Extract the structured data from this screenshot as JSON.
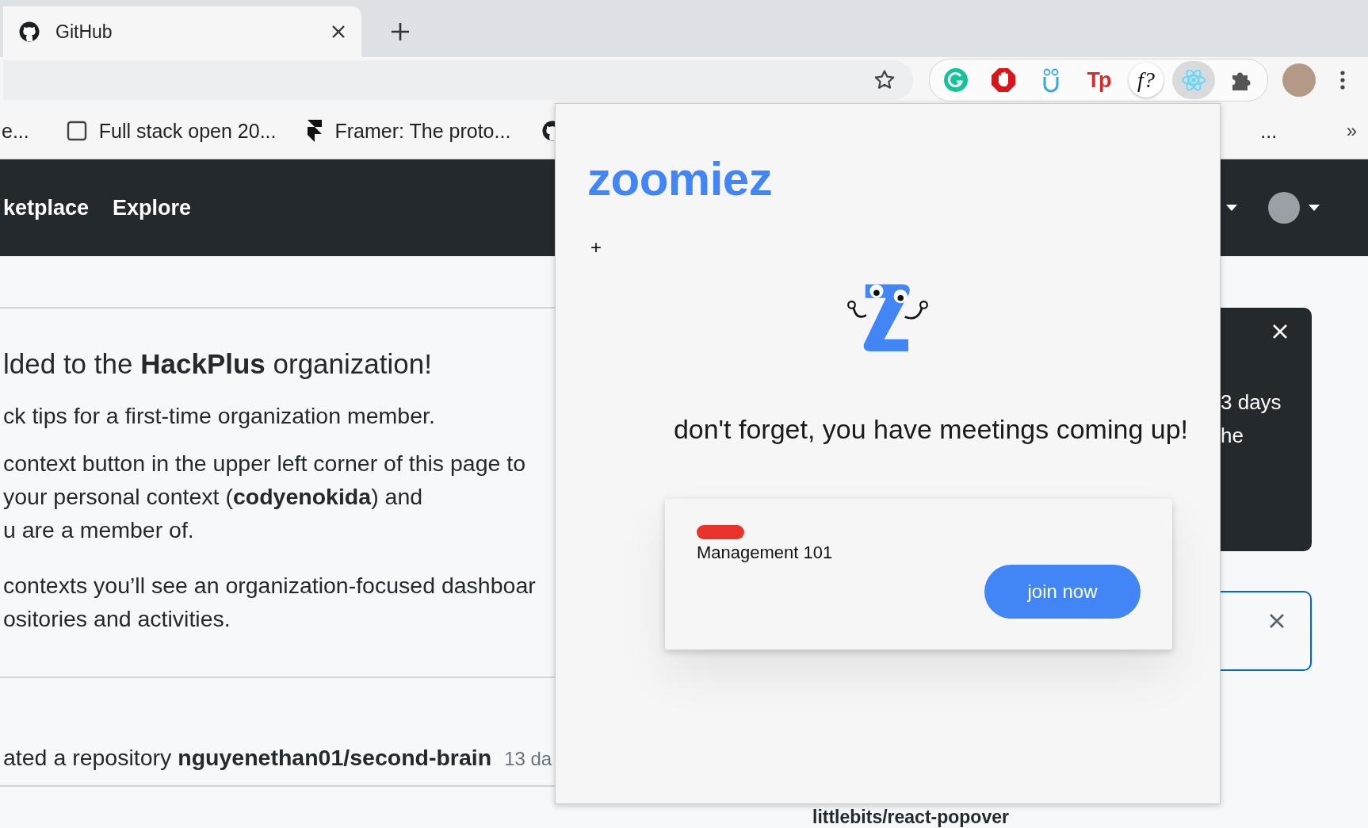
{
  "browser": {
    "tabs": [
      {
        "title": "GitHub",
        "selected": true
      }
    ],
    "extensions": [
      {
        "kind": "grammarly",
        "selected": false
      },
      {
        "kind": "stop-hand",
        "selected": false
      },
      {
        "kind": "owl",
        "selected": false
      },
      {
        "kind": "text",
        "label": "Tp",
        "selected": false
      },
      {
        "kind": "text-circle",
        "label": "f?",
        "selected": false
      },
      {
        "kind": "atom",
        "selected": true
      },
      {
        "kind": "puzzle",
        "selected": false
      }
    ],
    "bookmarks": [
      {
        "kind": "plain",
        "label": "e..."
      },
      {
        "kind": "page",
        "label": "Full stack open 20..."
      },
      {
        "kind": "framer",
        "label": "Framer: The proto..."
      },
      {
        "kind": "github"
      },
      {
        "kind": "plain",
        "label": "..."
      }
    ],
    "bookmarks_overflow": "»"
  },
  "github": {
    "nav": [
      "ketplace",
      "Explore"
    ],
    "welcome": {
      "heading": "lded to the **HackPlus** organization!",
      "paragraphs": [
        [
          "ck tips for a first-time organization member."
        ],
        [
          "context button in the upper left corner of this page to",
          "your personal context (**codyenokida**) and",
          "u are a member of."
        ],
        [
          "contexts you’ll see an organization-focused dashboar",
          "ositories and activities."
        ]
      ]
    },
    "activity": {
      "text": "ated a repository **nguyenethan01/second-brain**",
      "time": "13 da"
    },
    "repo_link": "littlebits/react-popover",
    "side_card": {
      "lines": [
        "3 days",
        "he"
      ]
    }
  },
  "popup": {
    "title": "zoomiez",
    "add_button": "+",
    "message": "don't forget, you have meetings coming up!",
    "meetings": [
      {
        "name": "Management 101",
        "color": "#e8332a",
        "action": "join now"
      }
    ]
  }
}
